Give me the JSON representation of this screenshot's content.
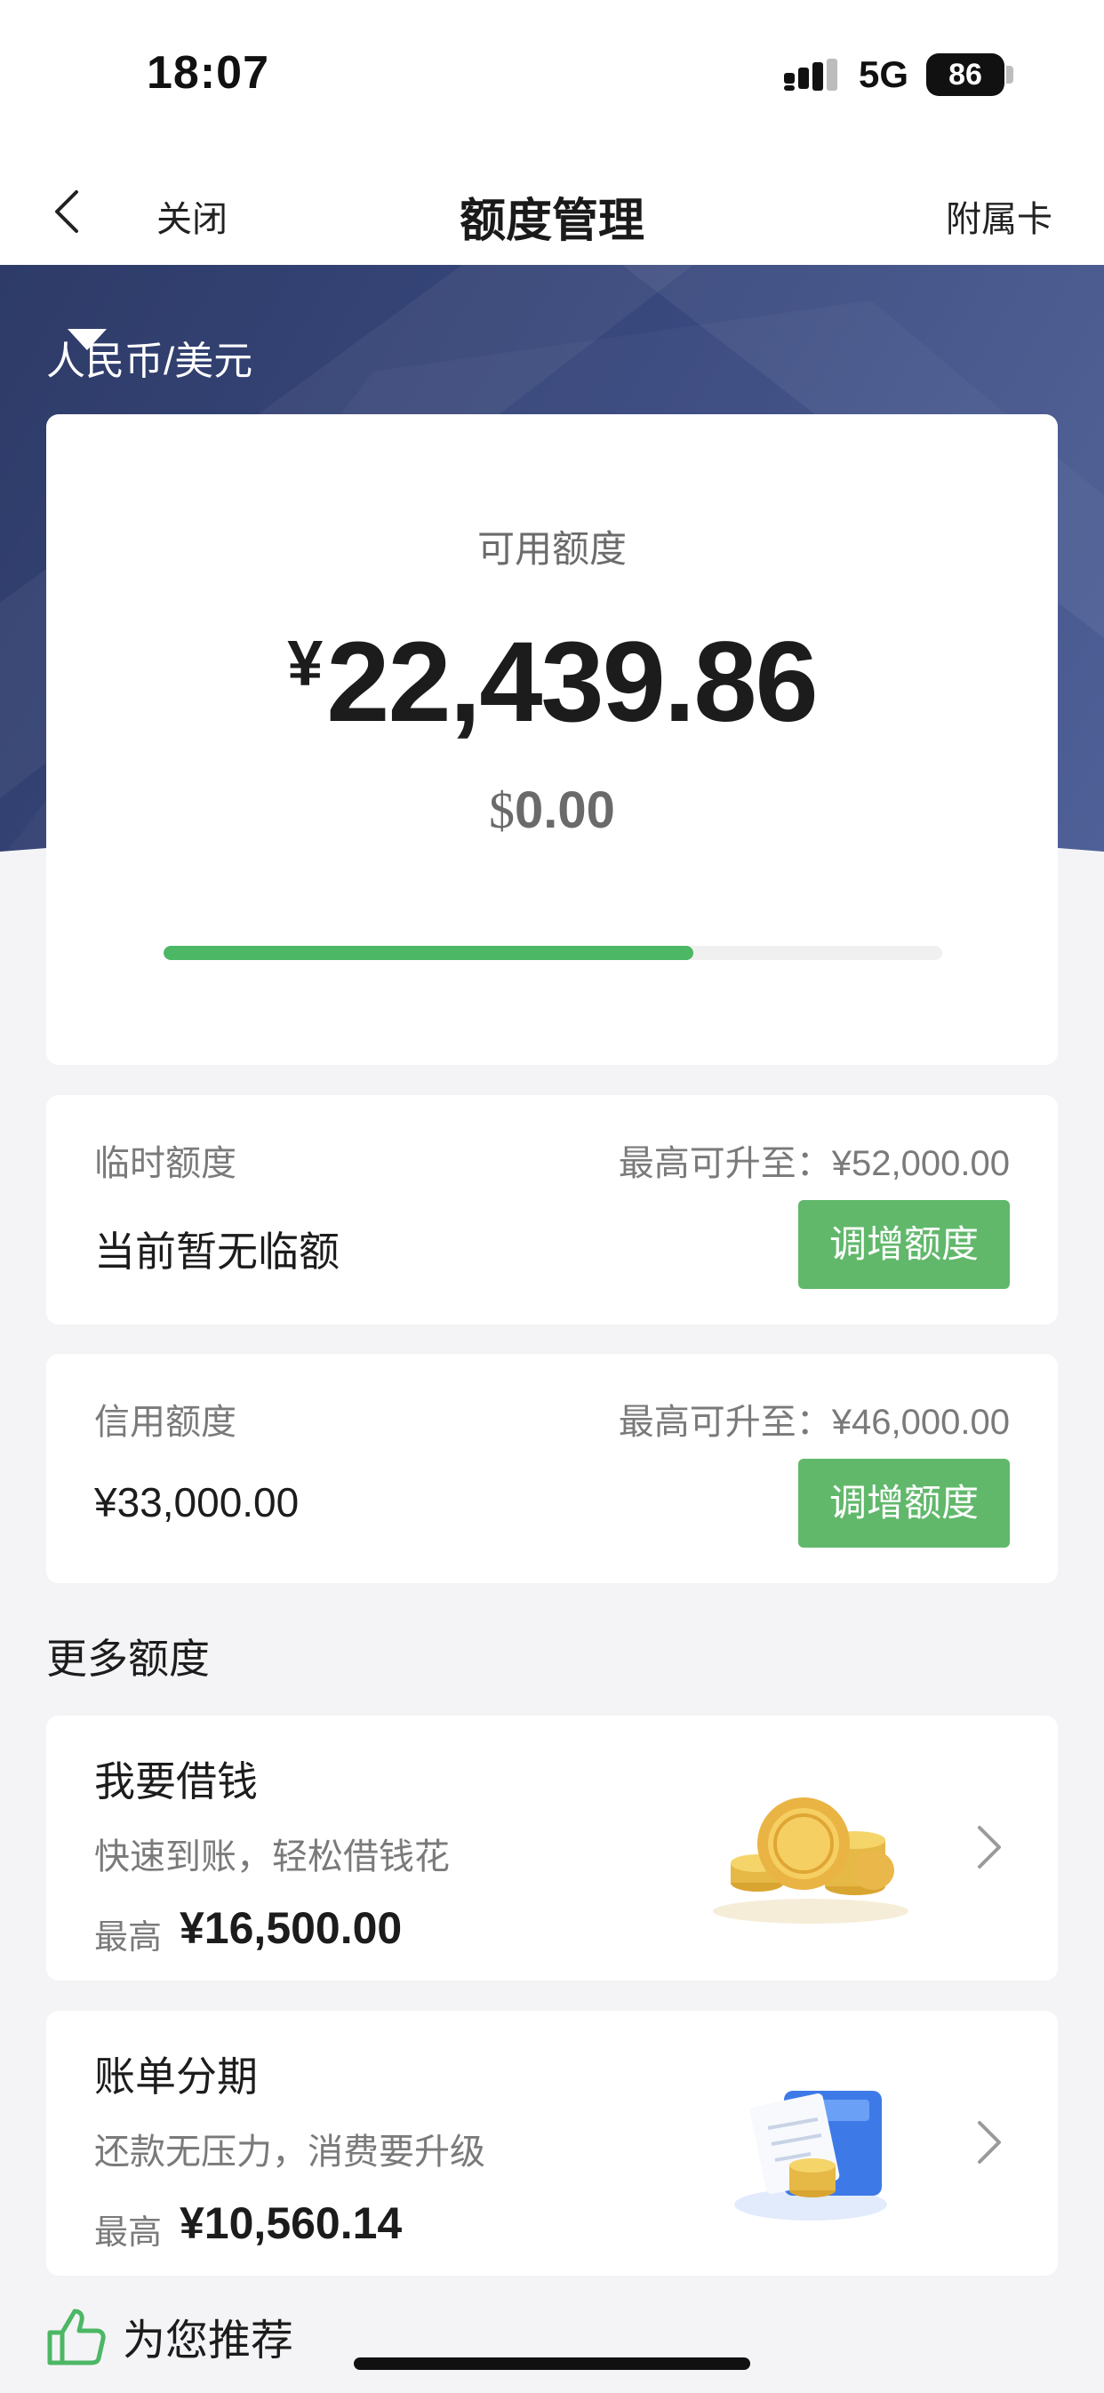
{
  "status_bar": {
    "time": "18:07",
    "network": "5G",
    "battery": "86"
  },
  "nav": {
    "back_icon": "chevron-left-icon",
    "close_label": "关闭",
    "title": "额度管理",
    "subcard_label": "附属卡"
  },
  "currency_selector": {
    "label": "人民币/美元",
    "icon": "caret-down-icon"
  },
  "available": {
    "label": "可用额度",
    "cny_symbol": "¥",
    "cny_amount": "22,439.86",
    "usd_symbol": "$",
    "usd_amount": "0.00",
    "progress_fraction": 0.68,
    "progress_color": "#4cb765"
  },
  "temp_limit": {
    "title": "临时额度",
    "max_text": "最高可升至：¥52,000.00",
    "value": "当前暂无临额",
    "button_label": "调增额度"
  },
  "credit_limit": {
    "title": "信用额度",
    "max_text": "最高可升至：¥46,000.00",
    "value": "¥33,000.00",
    "button_label": "调增额度"
  },
  "more_section": {
    "title": "更多额度"
  },
  "offers": [
    {
      "title": "我要借钱",
      "desc": "快速到账，轻松借钱花",
      "max_label": "最高",
      "max_value": "¥16,500.00",
      "icon": "gold-coins-icon"
    },
    {
      "title": "账单分期",
      "desc": "还款无压力，消费要升级",
      "max_label": "最高",
      "max_value": "¥10,560.14",
      "icon": "bill-card-icon"
    }
  ],
  "recommend": {
    "label": "为您推荐",
    "icon": "thumbs-up-icon"
  },
  "colors": {
    "banner": "#34447a",
    "accent_green": "#61b86b",
    "background": "#f4f4f6"
  }
}
